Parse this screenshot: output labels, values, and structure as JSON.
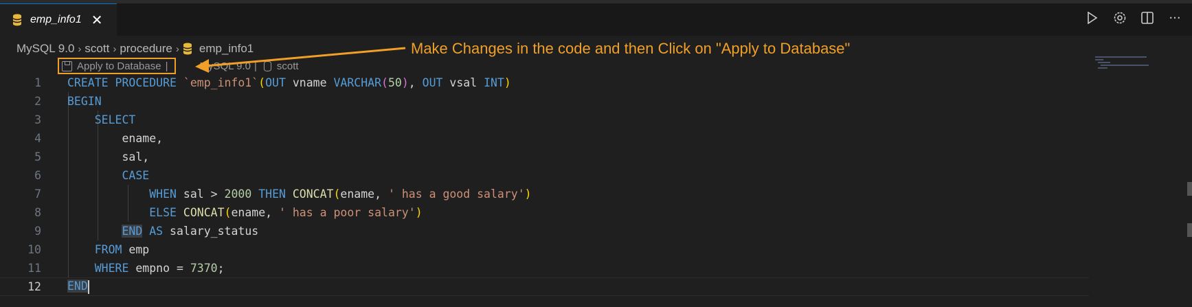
{
  "tab": {
    "title": "emp_info1",
    "close": "✕"
  },
  "tab_actions": {
    "run": "▷",
    "settings": "⚙",
    "split": "◫",
    "more": "···"
  },
  "breadcrumb": {
    "connection": "MySQL 9.0",
    "schema": "scott",
    "folder": "procedure",
    "object": "emp_info1",
    "sep": "›"
  },
  "codelens": {
    "apply": "Apply to Database",
    "bar": "|",
    "connection": "MySQL 9.0",
    "bar2": "|",
    "schema": "scott"
  },
  "annotation": {
    "text": "Make Changes in the code  and then Click on \"Apply to Database\""
  },
  "editor": {
    "line_numbers": [
      "1",
      "2",
      "3",
      "4",
      "5",
      "6",
      "7",
      "8",
      "9",
      "10",
      "11",
      "12"
    ],
    "l1": {
      "create": "CREATE PROCEDURE",
      "name": "`emp_info1`",
      "lp": "(",
      "out1": "OUT",
      "p1": " vname ",
      "t1": "VARCHAR",
      "lp2": "(",
      "n50": "50",
      "rp2": ")",
      "comma": ", ",
      "out2": "OUT",
      "p2": " vsal ",
      "t2": "INT",
      "rp": ")"
    },
    "l2": {
      "begin": "BEGIN"
    },
    "l3": {
      "select": "SELECT"
    },
    "l4": {
      "text": "ename,"
    },
    "l5": {
      "text": "sal,"
    },
    "l6": {
      "case": "CASE"
    },
    "l7": {
      "when": "WHEN",
      "cond": " sal > ",
      "n": "2000",
      "then": " THEN ",
      "fn": "CONCAT",
      "lp": "(",
      "arg": "ename, ",
      "str": "' has a good salary'",
      "rp": ")"
    },
    "l8": {
      "else": "ELSE",
      "sp": " ",
      "fn": "CONCAT",
      "lp": "(",
      "arg": "ename, ",
      "str": "' has a poor salary'",
      "rp": ")"
    },
    "l9": {
      "end": "END",
      "as": " AS",
      "alias": " salary_status"
    },
    "l10": {
      "from": "FROM",
      "tbl": " emp"
    },
    "l11": {
      "where": "WHERE",
      "cond": " empno = ",
      "n": "7370",
      "semi": ";"
    },
    "l12": {
      "end": "END"
    }
  },
  "colors": {
    "accent": "#f0a028",
    "keyword": "#569cd6",
    "string": "#ce9178",
    "function": "#dcdcaa",
    "number": "#b5cea8"
  }
}
